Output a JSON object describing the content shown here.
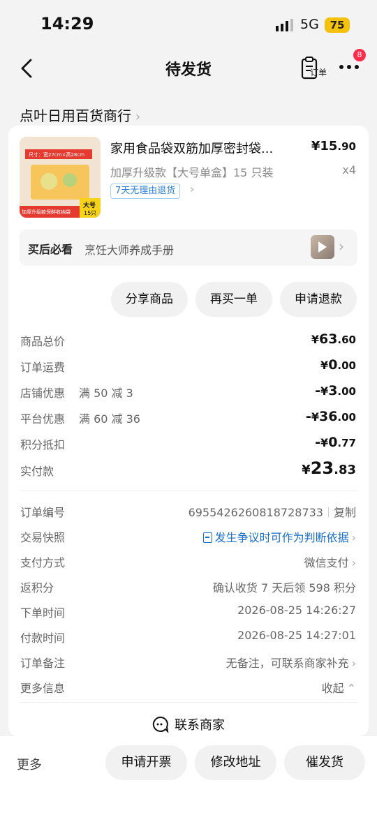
{
  "status_bar": {
    "time": "14:29",
    "network": "5G",
    "battery": "75"
  },
  "nav": {
    "title": "待发货",
    "order_label": "订单",
    "badge_count": "8"
  },
  "shop": {
    "name": "点叶日用百货商行"
  },
  "product": {
    "title": "家用食品袋双筋加厚密封袋...",
    "price_symbol": "¥",
    "price_int": "15",
    "price_dec": ".90",
    "spec": "加厚升级款【大号单盒】15 只装",
    "qty": "x4",
    "return_tag": "7天无理由退货",
    "thumb_texts": {
      "size": "尺寸：宽27cm×高28cm",
      "banner": "加厚升级款保鲜收纳袋",
      "big": "大号",
      "count": "15只"
    }
  },
  "guide": {
    "label": "买后必看",
    "text": "烹饪大师养成手册"
  },
  "actions": {
    "share": "分享商品",
    "rebuy": "再买一单",
    "refund": "申请退款"
  },
  "costs": [
    {
      "label": "商品总价",
      "sub": "",
      "sign": "",
      "cur": "¥",
      "int": "63",
      "dec": ".60"
    },
    {
      "label": "订单运费",
      "sub": "",
      "sign": "",
      "cur": "¥",
      "int": "0",
      "dec": ".00"
    },
    {
      "label": "店铺优惠",
      "sub": "满 50 减 3",
      "sign": "-",
      "cur": "¥",
      "int": "3",
      "dec": ".00"
    },
    {
      "label": "平台优惠",
      "sub": "满 60 减 36",
      "sign": "-",
      "cur": "¥",
      "int": "36",
      "dec": ".00"
    },
    {
      "label": "积分抵扣",
      "sub": "",
      "sign": "-",
      "cur": "¥",
      "int": "0",
      "dec": ".77"
    }
  ],
  "paid": {
    "label": "实付款",
    "cur": "¥",
    "int": "23",
    "dec": ".83"
  },
  "info": {
    "order_no_label": "订单编号",
    "order_no": "6955426260818728733",
    "copy": "复制",
    "snapshot_label": "交易快照",
    "snapshot_value": "发生争议时可作为判断依据",
    "pay_label": "支付方式",
    "pay_value": "微信支付",
    "points_label": "返积分",
    "points_value": "确认收货 7 天后领 598 积分",
    "order_time_label": "下单时间",
    "order_time": "2026-08-25 14:26:27",
    "pay_time_label": "付款时间",
    "pay_time": "2026-08-25 14:27:01",
    "remark_label": "订单备注",
    "remark_value": "无备注，可联系商家补充",
    "more_label": "更多信息",
    "more_value": "收起"
  },
  "contact": {
    "label": "联系商家"
  },
  "bottom": {
    "more": "更多",
    "invoice": "申请开票",
    "address": "修改地址",
    "urge": "催发货"
  },
  "colors": {
    "accent_blue": "#2b7fd8",
    "badge_red": "#ff2d4a",
    "battery_yellow": "#f4c10e"
  }
}
